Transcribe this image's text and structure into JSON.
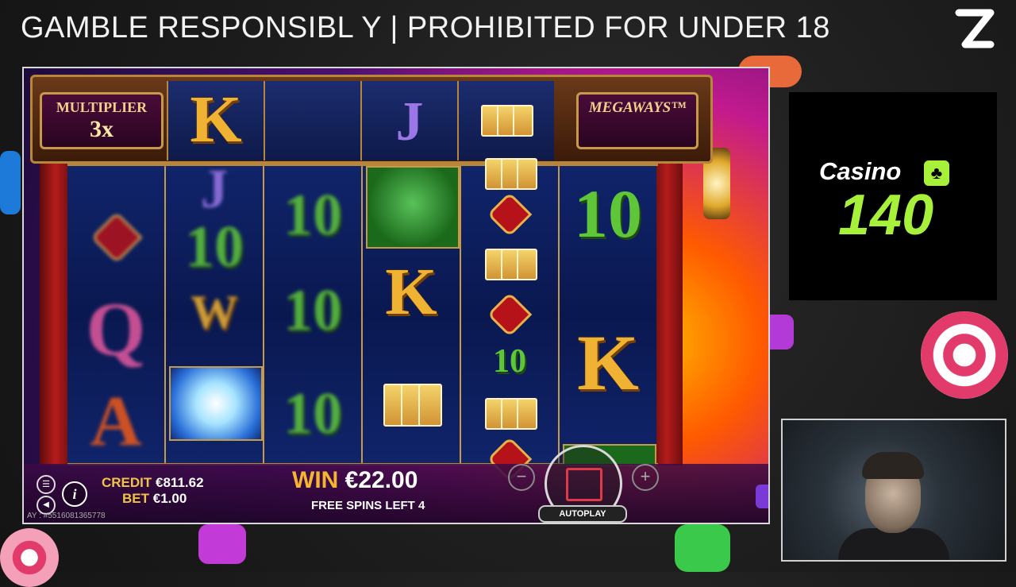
{
  "banner": {
    "text": "GAMBLE RESPONSIBL Y | PROHIBITED FOR UNDER 18"
  },
  "game": {
    "multiplier_label": "MULTIPLIER",
    "multiplier_value": "3x",
    "megaways_label": "MEGAWAYS™",
    "top_reel_symbols": [
      "K",
      "J",
      "cards"
    ],
    "reels": [
      [
        "heart",
        "Q",
        "A"
      ],
      [
        "J",
        "10",
        "W",
        "orb"
      ],
      [
        "10",
        "10",
        "10"
      ],
      [
        "owl",
        "K",
        "cards"
      ],
      [
        "cards",
        "heart",
        "cards",
        "heart",
        "10",
        "cards",
        "heart"
      ],
      [
        "10",
        "K",
        "wild"
      ]
    ],
    "credit_label": "CREDIT",
    "credit_value": "€811.62",
    "bet_label": "BET",
    "bet_value": "€1.00",
    "win_label": "WIN",
    "win_value": "€22.00",
    "free_spins_label": "FREE SPINS LEFT 4",
    "autoplay_label": "AUTOPLAY",
    "round_id": "AY : #5516081365778",
    "info_glyph": "i",
    "minus_glyph": "−",
    "plus_glyph": "+"
  },
  "sidebar": {
    "logo_word": "Casino",
    "logo_number": "140",
    "logo_suit": "♣"
  },
  "colors": {
    "gold": "#f0b233",
    "green_ten": "#5fc63a",
    "win_yellow": "#f5b530",
    "logo_green": "#a8f13a"
  }
}
